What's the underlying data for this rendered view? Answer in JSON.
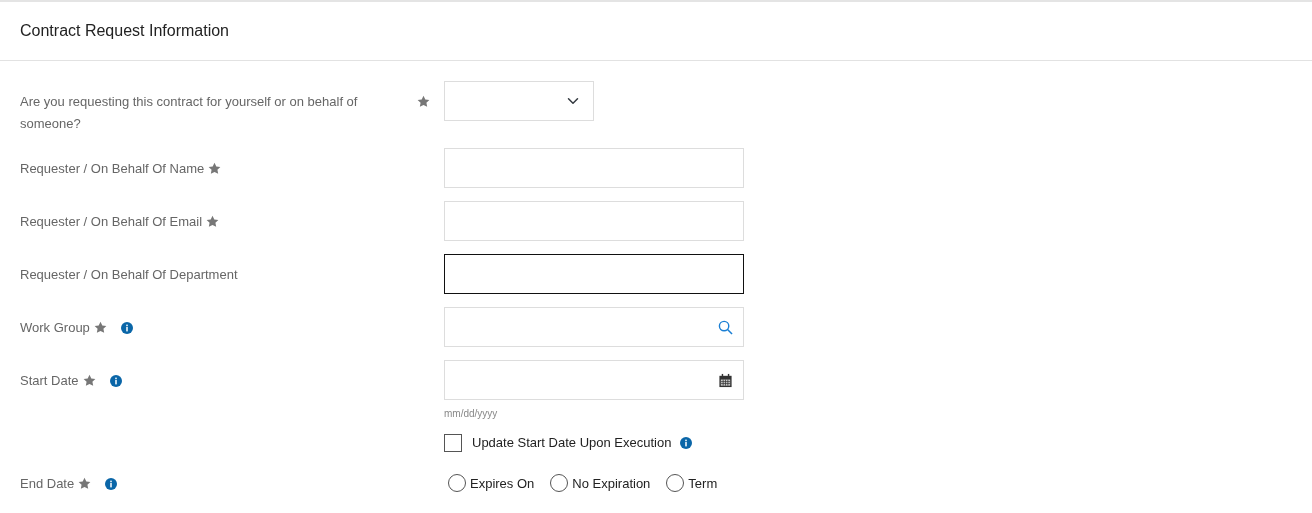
{
  "title": "Contract Request Information",
  "fields": [
    {
      "kind": "select",
      "label": "Are you requesting this contract for yourself or on behalf of someone?",
      "required": true,
      "info": false
    },
    {
      "kind": "text",
      "label": "Requester / On Behalf Of Name",
      "required": true,
      "info": false,
      "focused": false
    },
    {
      "kind": "text",
      "label": "Requester / On Behalf Of Email",
      "required": true,
      "info": false,
      "focused": false
    },
    {
      "kind": "text",
      "label": "Requester / On Behalf Of Department",
      "required": false,
      "info": false,
      "focused": true
    },
    {
      "kind": "lookup",
      "label": "Work Group",
      "required": true,
      "info": true
    },
    {
      "kind": "date",
      "label": "Start Date",
      "required": true,
      "info": true,
      "hint": "mm/dd/yyyy"
    },
    {
      "kind": "checkbox",
      "label": "Update Start Date Upon Execution",
      "checked": false,
      "info": true
    },
    {
      "kind": "radio",
      "label": "End Date",
      "required": true,
      "info": true,
      "options": [
        {
          "label": "Expires On",
          "selected": false
        },
        {
          "label": "No Expiration",
          "selected": false
        },
        {
          "label": "Term",
          "selected": false
        }
      ]
    }
  ]
}
